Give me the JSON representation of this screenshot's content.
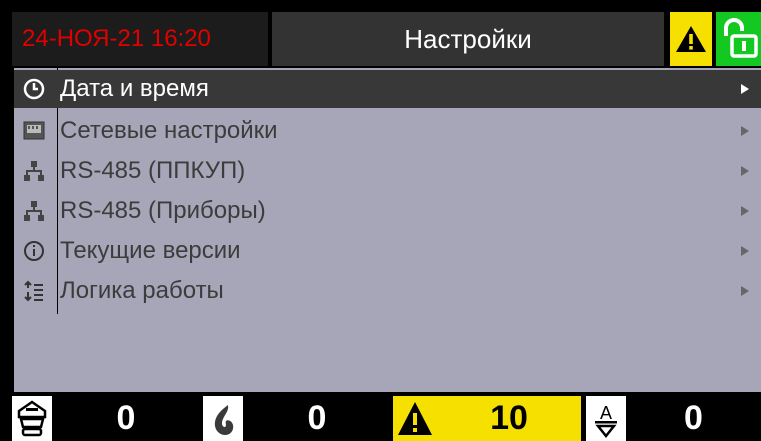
{
  "header": {
    "datetime": "24-НОЯ-21  16:20",
    "title": "Настройки",
    "warning_icon": "warning-triangle-icon",
    "lock_icon": "unlocked-padlock-icon"
  },
  "menu": {
    "items": [
      {
        "label": "Дата и время",
        "icon": "clock-icon",
        "selected": true
      },
      {
        "label": "Сетевые настройки",
        "icon": "network-card-icon",
        "selected": false
      },
      {
        "label": "RS-485 (ППКУП)",
        "icon": "network-topology-icon",
        "selected": false
      },
      {
        "label": "RS-485 (Приборы)",
        "icon": "network-topology-icon",
        "selected": false
      },
      {
        "label": "Текущие версии",
        "icon": "info-icon",
        "selected": false
      },
      {
        "label": "Логика работы",
        "icon": "logic-icon",
        "selected": false
      }
    ]
  },
  "footer": {
    "counters": [
      {
        "icon": "detector-icon",
        "value": "0"
      },
      {
        "icon": "fire-icon",
        "value": "0"
      },
      {
        "icon": "warning-icon",
        "value": "10"
      },
      {
        "icon": "automatics-icon",
        "value": "0"
      }
    ]
  },
  "colors": {
    "datetime": "#e00000",
    "warning": "#f5e000",
    "lock": "#13c820",
    "menu_bg": "#a6a6b8",
    "selected_bg": "#383838"
  }
}
